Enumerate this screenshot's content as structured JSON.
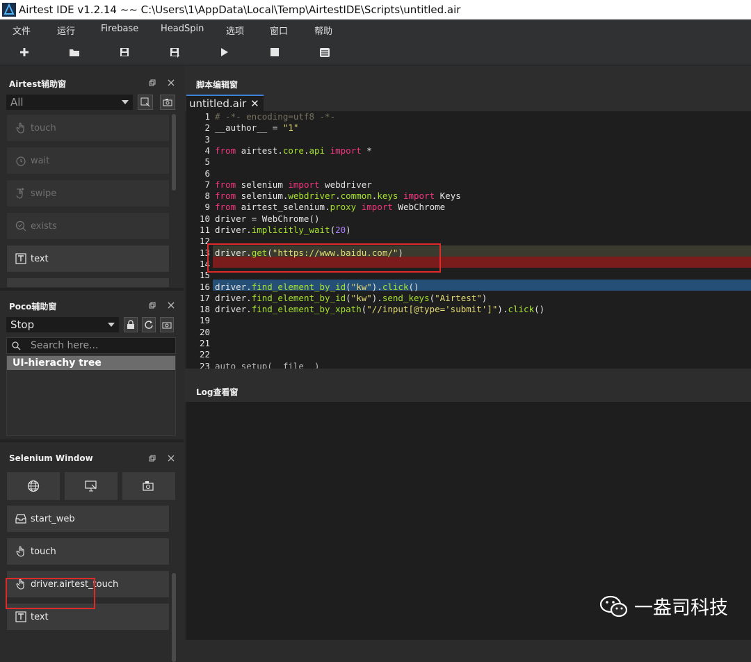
{
  "window": {
    "title": "Airtest IDE v1.2.14 ~~ C:\\Users\\1\\AppData\\Local\\Temp\\AirtestIDE\\Scripts\\untitled.air"
  },
  "menu": [
    "文件",
    "运行",
    "Firebase",
    "HeadSpin",
    "选项",
    "窗口",
    "帮助"
  ],
  "toolbar_icons": [
    "new-file-icon",
    "open-folder-icon",
    "save-icon",
    "save-as-icon",
    "run-icon",
    "stop-icon",
    "log-icon"
  ],
  "airtest_panel": {
    "title": "Airtest辅助窗",
    "filter": "All",
    "commands": [
      "touch",
      "wait",
      "swipe",
      "exists",
      "text"
    ]
  },
  "poco_panel": {
    "title": "Poco辅助窗",
    "mode": "Stop",
    "search_placeholder": "Search here...",
    "tree_root": "UI-hierachy tree"
  },
  "selenium_panel": {
    "title": "Selenium Window",
    "commands": [
      "start_web",
      "touch",
      "driver.airtest_touch",
      "text"
    ]
  },
  "editor": {
    "title": "脚本编辑窗",
    "tab": "untitled.air",
    "lines": [
      {
        "n": "1"
      },
      {
        "n": "2"
      },
      {
        "n": "3"
      },
      {
        "n": "4"
      },
      {
        "n": "5"
      },
      {
        "n": "6"
      },
      {
        "n": "7"
      },
      {
        "n": "8"
      },
      {
        "n": "9"
      },
      {
        "n": "10"
      },
      {
        "n": "11"
      },
      {
        "n": "12"
      },
      {
        "n": "13"
      },
      {
        "n": "14"
      },
      {
        "n": "15"
      },
      {
        "n": "16"
      },
      {
        "n": "17"
      },
      {
        "n": "18"
      },
      {
        "n": "19"
      },
      {
        "n": "20"
      },
      {
        "n": "21"
      },
      {
        "n": "22"
      },
      {
        "n": "23"
      }
    ]
  },
  "log": {
    "title": "Log查看窗"
  },
  "watermark": "一盎司科技",
  "colors": {
    "accent_blue": "#3c7fd6",
    "error_red": "#7a1c1c",
    "highlight_red_box": "#e02a2a",
    "selection_blue": "#264f78"
  }
}
